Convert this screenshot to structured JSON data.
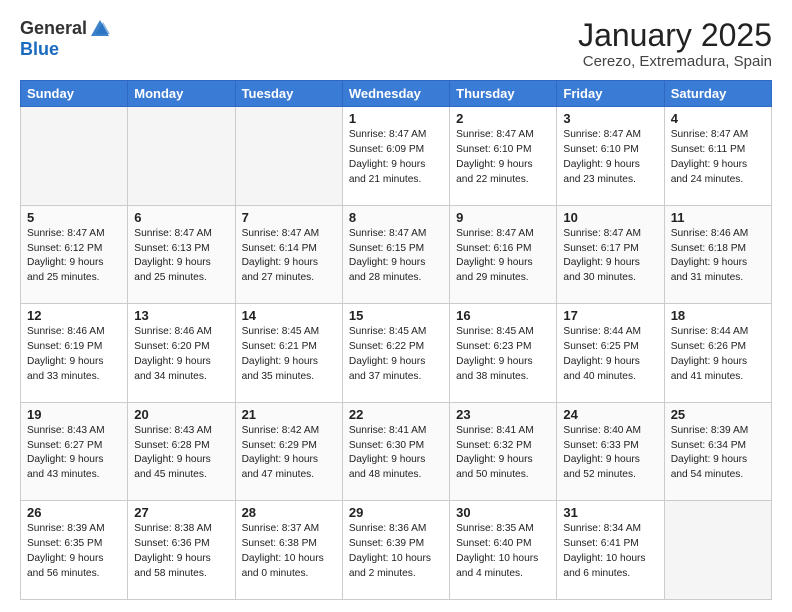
{
  "header": {
    "logo_general": "General",
    "logo_blue": "Blue",
    "month": "January 2025",
    "location": "Cerezo, Extremadura, Spain"
  },
  "days_of_week": [
    "Sunday",
    "Monday",
    "Tuesday",
    "Wednesday",
    "Thursday",
    "Friday",
    "Saturday"
  ],
  "weeks": [
    [
      {
        "num": "",
        "info": ""
      },
      {
        "num": "",
        "info": ""
      },
      {
        "num": "",
        "info": ""
      },
      {
        "num": "1",
        "info": "Sunrise: 8:47 AM\nSunset: 6:09 PM\nDaylight: 9 hours\nand 21 minutes."
      },
      {
        "num": "2",
        "info": "Sunrise: 8:47 AM\nSunset: 6:10 PM\nDaylight: 9 hours\nand 22 minutes."
      },
      {
        "num": "3",
        "info": "Sunrise: 8:47 AM\nSunset: 6:10 PM\nDaylight: 9 hours\nand 23 minutes."
      },
      {
        "num": "4",
        "info": "Sunrise: 8:47 AM\nSunset: 6:11 PM\nDaylight: 9 hours\nand 24 minutes."
      }
    ],
    [
      {
        "num": "5",
        "info": "Sunrise: 8:47 AM\nSunset: 6:12 PM\nDaylight: 9 hours\nand 25 minutes."
      },
      {
        "num": "6",
        "info": "Sunrise: 8:47 AM\nSunset: 6:13 PM\nDaylight: 9 hours\nand 25 minutes."
      },
      {
        "num": "7",
        "info": "Sunrise: 8:47 AM\nSunset: 6:14 PM\nDaylight: 9 hours\nand 27 minutes."
      },
      {
        "num": "8",
        "info": "Sunrise: 8:47 AM\nSunset: 6:15 PM\nDaylight: 9 hours\nand 28 minutes."
      },
      {
        "num": "9",
        "info": "Sunrise: 8:47 AM\nSunset: 6:16 PM\nDaylight: 9 hours\nand 29 minutes."
      },
      {
        "num": "10",
        "info": "Sunrise: 8:47 AM\nSunset: 6:17 PM\nDaylight: 9 hours\nand 30 minutes."
      },
      {
        "num": "11",
        "info": "Sunrise: 8:46 AM\nSunset: 6:18 PM\nDaylight: 9 hours\nand 31 minutes."
      }
    ],
    [
      {
        "num": "12",
        "info": "Sunrise: 8:46 AM\nSunset: 6:19 PM\nDaylight: 9 hours\nand 33 minutes."
      },
      {
        "num": "13",
        "info": "Sunrise: 8:46 AM\nSunset: 6:20 PM\nDaylight: 9 hours\nand 34 minutes."
      },
      {
        "num": "14",
        "info": "Sunrise: 8:45 AM\nSunset: 6:21 PM\nDaylight: 9 hours\nand 35 minutes."
      },
      {
        "num": "15",
        "info": "Sunrise: 8:45 AM\nSunset: 6:22 PM\nDaylight: 9 hours\nand 37 minutes."
      },
      {
        "num": "16",
        "info": "Sunrise: 8:45 AM\nSunset: 6:23 PM\nDaylight: 9 hours\nand 38 minutes."
      },
      {
        "num": "17",
        "info": "Sunrise: 8:44 AM\nSunset: 6:25 PM\nDaylight: 9 hours\nand 40 minutes."
      },
      {
        "num": "18",
        "info": "Sunrise: 8:44 AM\nSunset: 6:26 PM\nDaylight: 9 hours\nand 41 minutes."
      }
    ],
    [
      {
        "num": "19",
        "info": "Sunrise: 8:43 AM\nSunset: 6:27 PM\nDaylight: 9 hours\nand 43 minutes."
      },
      {
        "num": "20",
        "info": "Sunrise: 8:43 AM\nSunset: 6:28 PM\nDaylight: 9 hours\nand 45 minutes."
      },
      {
        "num": "21",
        "info": "Sunrise: 8:42 AM\nSunset: 6:29 PM\nDaylight: 9 hours\nand 47 minutes."
      },
      {
        "num": "22",
        "info": "Sunrise: 8:41 AM\nSunset: 6:30 PM\nDaylight: 9 hours\nand 48 minutes."
      },
      {
        "num": "23",
        "info": "Sunrise: 8:41 AM\nSunset: 6:32 PM\nDaylight: 9 hours\nand 50 minutes."
      },
      {
        "num": "24",
        "info": "Sunrise: 8:40 AM\nSunset: 6:33 PM\nDaylight: 9 hours\nand 52 minutes."
      },
      {
        "num": "25",
        "info": "Sunrise: 8:39 AM\nSunset: 6:34 PM\nDaylight: 9 hours\nand 54 minutes."
      }
    ],
    [
      {
        "num": "26",
        "info": "Sunrise: 8:39 AM\nSunset: 6:35 PM\nDaylight: 9 hours\nand 56 minutes."
      },
      {
        "num": "27",
        "info": "Sunrise: 8:38 AM\nSunset: 6:36 PM\nDaylight: 9 hours\nand 58 minutes."
      },
      {
        "num": "28",
        "info": "Sunrise: 8:37 AM\nSunset: 6:38 PM\nDaylight: 10 hours\nand 0 minutes."
      },
      {
        "num": "29",
        "info": "Sunrise: 8:36 AM\nSunset: 6:39 PM\nDaylight: 10 hours\nand 2 minutes."
      },
      {
        "num": "30",
        "info": "Sunrise: 8:35 AM\nSunset: 6:40 PM\nDaylight: 10 hours\nand 4 minutes."
      },
      {
        "num": "31",
        "info": "Sunrise: 8:34 AM\nSunset: 6:41 PM\nDaylight: 10 hours\nand 6 minutes."
      },
      {
        "num": "",
        "info": ""
      }
    ]
  ]
}
